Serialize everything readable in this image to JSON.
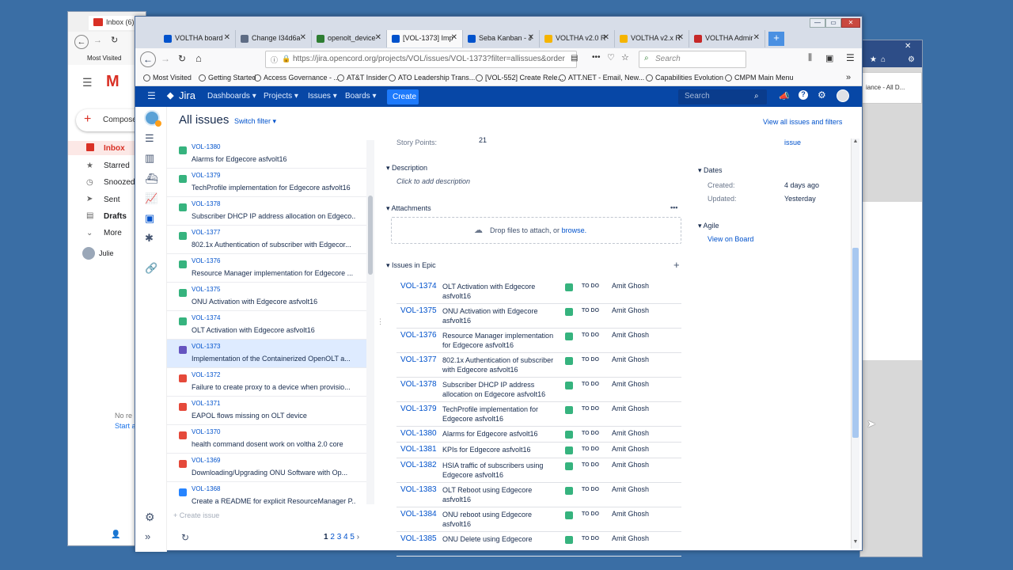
{
  "bg_gmail": {
    "tab": "Inbox (6)",
    "bookmark": "Most Visited",
    "nav": [
      "Inbox",
      "Starred",
      "Snoozed",
      "Sent",
      "Drafts",
      "More"
    ],
    "compose": "Compose",
    "user": "Julie",
    "no_text": "No re",
    "start": "Start a"
  },
  "bg_right": {
    "text": "iance - All D..."
  },
  "browser": {
    "tabs": [
      {
        "label": "VOLTHA board",
        "color": "#0052cc",
        "active": false
      },
      {
        "label": "Change I34d6a",
        "color": "#5e6c84",
        "active": false
      },
      {
        "label": "openolt_device",
        "color": "#2e7d32",
        "active": false
      },
      {
        "label": "[VOL-1373] Imp",
        "color": "#0052cc",
        "active": true
      },
      {
        "label": "Seba Kanban - J",
        "color": "#0052cc",
        "active": false
      },
      {
        "label": "VOLTHA v2.0 R",
        "color": "#f5b400",
        "active": false
      },
      {
        "label": "VOLTHA v2.x R",
        "color": "#f5b400",
        "active": false
      },
      {
        "label": "VOLTHA Admir",
        "color": "#c62828",
        "active": false
      }
    ],
    "url": "https://jira.opencord.org/projects/VOL/issues/VOL-1373?filter=allissues&order",
    "search_placeholder": "Search",
    "bookmarks": [
      "Most Visited",
      "Getting Started",
      "Access Governance - ...",
      "AT&T Insider",
      "ATO Leadership Trans...",
      "[VOL-552] Create Rele...",
      "ATT.NET - Email, New...",
      "Capabilities Evolution",
      "CMPM Main Menu"
    ]
  },
  "jira": {
    "logo": "Jira",
    "nav": [
      "Dashboards",
      "Projects",
      "Issues",
      "Boards"
    ],
    "create": "Create",
    "search_placeholder": "Search",
    "page_title": "All issues",
    "switch_filter": "Switch filter",
    "view_all": "View all issues and filters",
    "issues": [
      {
        "key": "VOL-1380",
        "summary": "Alarms for Edgecore asfvolt16",
        "type": "story"
      },
      {
        "key": "VOL-1379",
        "summary": "TechProfile implementation for Edgecore asfvolt16",
        "type": "story"
      },
      {
        "key": "VOL-1378",
        "summary": "Subscriber DHCP IP address allocation on Edgeco...",
        "type": "story"
      },
      {
        "key": "VOL-1377",
        "summary": "802.1x Authentication of subscriber with Edgecor...",
        "type": "story"
      },
      {
        "key": "VOL-1376",
        "summary": "Resource Manager implementation for Edgecore ...",
        "type": "story"
      },
      {
        "key": "VOL-1375",
        "summary": "ONU Activation with Edgecore asfvolt16",
        "type": "story"
      },
      {
        "key": "VOL-1374",
        "summary": "OLT Activation with Edgecore asfvolt16",
        "type": "story"
      },
      {
        "key": "VOL-1373",
        "summary": "Implementation of the Containerized OpenOLT a...",
        "type": "epic"
      },
      {
        "key": "VOL-1372",
        "summary": "Failure to create proxy to a device when provisio...",
        "type": "bug"
      },
      {
        "key": "VOL-1371",
        "summary": "EAPOL flows missing on OLT device",
        "type": "bug"
      },
      {
        "key": "VOL-1370",
        "summary": "health command dosent work on voltha 2.0 core",
        "type": "bug"
      },
      {
        "key": "VOL-1369",
        "summary": "Downloading/Upgrading ONU Software with Op...",
        "type": "bug"
      },
      {
        "key": "VOL-1368",
        "summary": "Create a README for explicit ResourceManager P...",
        "type": "task"
      }
    ],
    "create_issue": "+ Create issue",
    "pages": [
      "1",
      "2",
      "3",
      "4",
      "5"
    ],
    "story_points_label": "Story Points:",
    "story_points": "21",
    "description_label": "Description",
    "description_placeholder": "Click to add description",
    "attachments_label": "Attachments",
    "drop_text": "Drop files to attach, or",
    "browse": "browse.",
    "epic_label": "Issues in Epic",
    "epic_issues": [
      {
        "key": "VOL-1374",
        "summary": "OLT Activation with Edgecore asfvolt16",
        "status": "TO DO",
        "assignee": "Amit Ghosh"
      },
      {
        "key": "VOL-1375",
        "summary": "ONU Activation with Edgecore asfvolt16",
        "status": "TO DO",
        "assignee": "Amit Ghosh"
      },
      {
        "key": "VOL-1376",
        "summary": "Resource Manager implementation for Edgecore asfvolt16",
        "status": "TO DO",
        "assignee": "Amit Ghosh"
      },
      {
        "key": "VOL-1377",
        "summary": "802.1x Authentication of subscriber with Edgecore asfvolt16",
        "status": "TO DO",
        "assignee": "Amit Ghosh"
      },
      {
        "key": "VOL-1378",
        "summary": "Subscriber DHCP IP address allocation on Edgecore asfvolt16",
        "status": "TO DO",
        "assignee": "Amit Ghosh"
      },
      {
        "key": "VOL-1379",
        "summary": "TechProfile implementation for Edgecore asfvolt16",
        "status": "TO DO",
        "assignee": "Amit Ghosh"
      },
      {
        "key": "VOL-1380",
        "summary": "Alarms for Edgecore asfvolt16",
        "status": "TO DO",
        "assignee": "Amit Ghosh"
      },
      {
        "key": "VOL-1381",
        "summary": "KPIs for Edgecore asfvolt16",
        "status": "TO DO",
        "assignee": "Amit Ghosh"
      },
      {
        "key": "VOL-1382",
        "summary": "HSIA traffic of subscribers using Edgecore asfvolt16",
        "status": "TO DO",
        "assignee": "Amit Ghosh"
      },
      {
        "key": "VOL-1383",
        "summary": "OLT Reboot using Edgecore asfvolt16",
        "status": "TO DO",
        "assignee": "Amit Ghosh"
      },
      {
        "key": "VOL-1384",
        "summary": "ONU reboot using Edgecore asfvolt16",
        "status": "TO DO",
        "assignee": "Amit Ghosh"
      },
      {
        "key": "VOL-1385",
        "summary": "ONU Delete using Edgecore",
        "status": "TO DO",
        "assignee": "Amit Ghosh"
      }
    ],
    "issue_link": "issue",
    "dates_label": "Dates",
    "created_label": "Created:",
    "created": "4 days ago",
    "updated_label": "Updated:",
    "updated": "Yesterday",
    "agile_label": "Agile",
    "view_on_board": "View on Board"
  }
}
